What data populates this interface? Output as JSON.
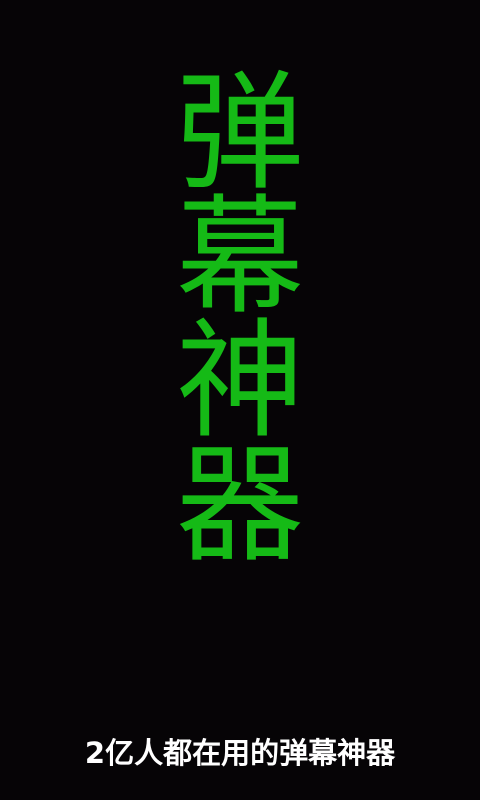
{
  "splash": {
    "title_chars": [
      "弹",
      "幕",
      "神",
      "器"
    ],
    "tagline": "2亿人都在用的弹幕神器"
  },
  "colors": {
    "background": "#060406",
    "title": "#15ba16",
    "tagline": "#ffffff"
  }
}
